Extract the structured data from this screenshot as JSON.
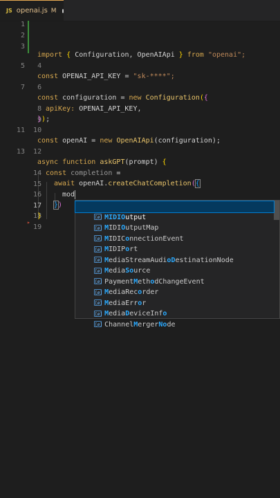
{
  "tab": {
    "icon": "JS",
    "filename": "openai.js",
    "status": "M",
    "dirty_icon": "dot-icon"
  },
  "lines": [
    {
      "n": "1"
    },
    {
      "n": "2"
    },
    {
      "n": "3"
    },
    {
      "n": "4"
    },
    {
      "n": "5"
    },
    {
      "n": "6"
    },
    {
      "n": "7"
    },
    {
      "n": "8"
    },
    {
      "n": "9"
    },
    {
      "n": "10"
    },
    {
      "n": "11"
    },
    {
      "n": "12"
    },
    {
      "n": "13"
    },
    {
      "n": "14"
    },
    {
      "n": "15"
    },
    {
      "n": "16"
    },
    {
      "n": "17"
    },
    {
      "n": "18"
    },
    {
      "n": "19"
    }
  ],
  "code": {
    "l4": [
      "import",
      "{",
      "Configuration,",
      "OpenAIApi",
      "}",
      "from",
      "\"openai\";"
    ],
    "l6": [
      "const",
      "OPENAI_API_KEY",
      "=",
      "\"sk-****\";"
    ],
    "l8": [
      "const",
      "configuration",
      "=",
      "new",
      "Configuration",
      "(",
      "{"
    ],
    "l9": [
      "apiKey:",
      "OPENAI_API_KEY,"
    ],
    "l10": [
      "}",
      ")",
      ";"
    ],
    "l12": [
      "const",
      "openAI",
      "=",
      "new",
      "OpenAIApi",
      "(configuration);"
    ],
    "l14": [
      "async",
      "function",
      "askGPT",
      "(prompt)",
      "{"
    ],
    "l15": [
      "const",
      "completion",
      "="
    ],
    "l16": [
      "await",
      "openAI.",
      "createChatCompletion",
      "(",
      "{"
    ],
    "l17": [
      "mod"
    ],
    "l18": [
      "}",
      ")"
    ],
    "l19": [
      "}"
    ]
  },
  "suggestions": [
    {
      "pre": "",
      "hl": "M",
      "mid": "",
      "hl2": "",
      "rest": "IDI",
      "hl3": "O",
      "post": "utput",
      "label": "MIDIOutput",
      "selected": true
    },
    {
      "label": "MIDIOutputMap"
    },
    {
      "label": "MIDIConnectionEvent"
    },
    {
      "label": "MIDIPort"
    },
    {
      "label": "MediaStreamAudioDestinationNode"
    },
    {
      "label": "MediaSource"
    },
    {
      "label": "PaymentMethodChangeEvent"
    },
    {
      "label": "MediaRecorder"
    },
    {
      "label": "MediaError"
    },
    {
      "label": "MediaDeviceInfo"
    },
    {
      "label": "ChannelMergerNode"
    }
  ],
  "suggestion_icon_text": "[ø]",
  "right_fragments": [
    "s",
    "v",
    "A",
    "("
  ]
}
